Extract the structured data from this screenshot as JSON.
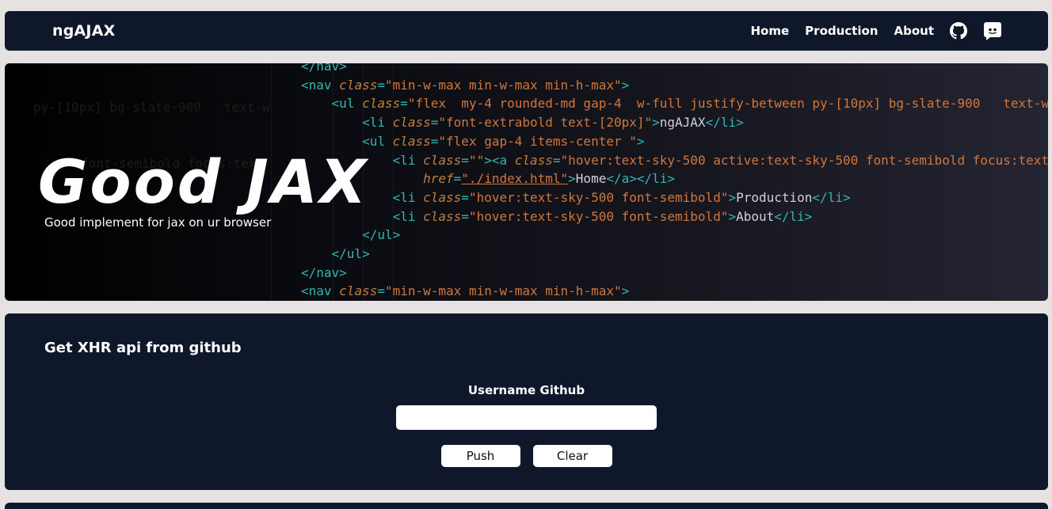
{
  "navbar": {
    "brand": "ngAJAX",
    "links": [
      "Home",
      "Production",
      "About"
    ],
    "icons": [
      "github-icon",
      "discord-icon"
    ]
  },
  "hero": {
    "title": "Good JAX",
    "subtitle": "Good implement for jax on ur browser"
  },
  "panel": {
    "title_prefix": "Get ",
    "title_bold": "XHR",
    "title_suffix": " api from github",
    "field_label": "Username Github",
    "field_value": "",
    "push_label": "Push",
    "clear_label": "Clear"
  },
  "colors": {
    "page_bg": "#e6e2e2",
    "panel_bg": "#0f172a",
    "text": "#ffffff"
  }
}
